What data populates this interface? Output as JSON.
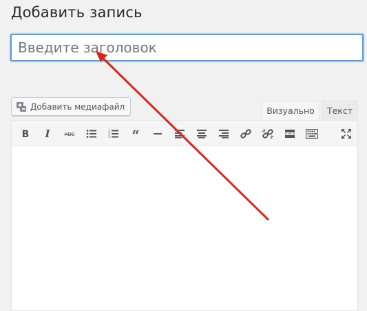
{
  "page": {
    "title": "Добавить запись"
  },
  "title_field": {
    "placeholder": "Введите заголовок",
    "value": ""
  },
  "media_button": {
    "label": "Добавить медиафайл"
  },
  "editor_tabs": [
    {
      "label": "Визуально",
      "active": true
    },
    {
      "label": "Текст",
      "active": false
    }
  ],
  "toolbar": {
    "buttons": [
      "bold-icon",
      "italic-icon",
      "strikethrough-icon",
      "bullet-list-icon",
      "numbered-list-icon",
      "blockquote-icon",
      "horizontal-line-icon",
      "align-left-icon",
      "align-center-icon",
      "align-right-icon",
      "link-icon",
      "unlink-icon",
      "read-more-icon",
      "toolbar-toggle-icon",
      "fullscreen-icon"
    ]
  },
  "annotation": {
    "arrow_color": "#d9261c"
  },
  "colors": {
    "focus_border": "#5b9dd9",
    "background": "#f1f1f1"
  }
}
